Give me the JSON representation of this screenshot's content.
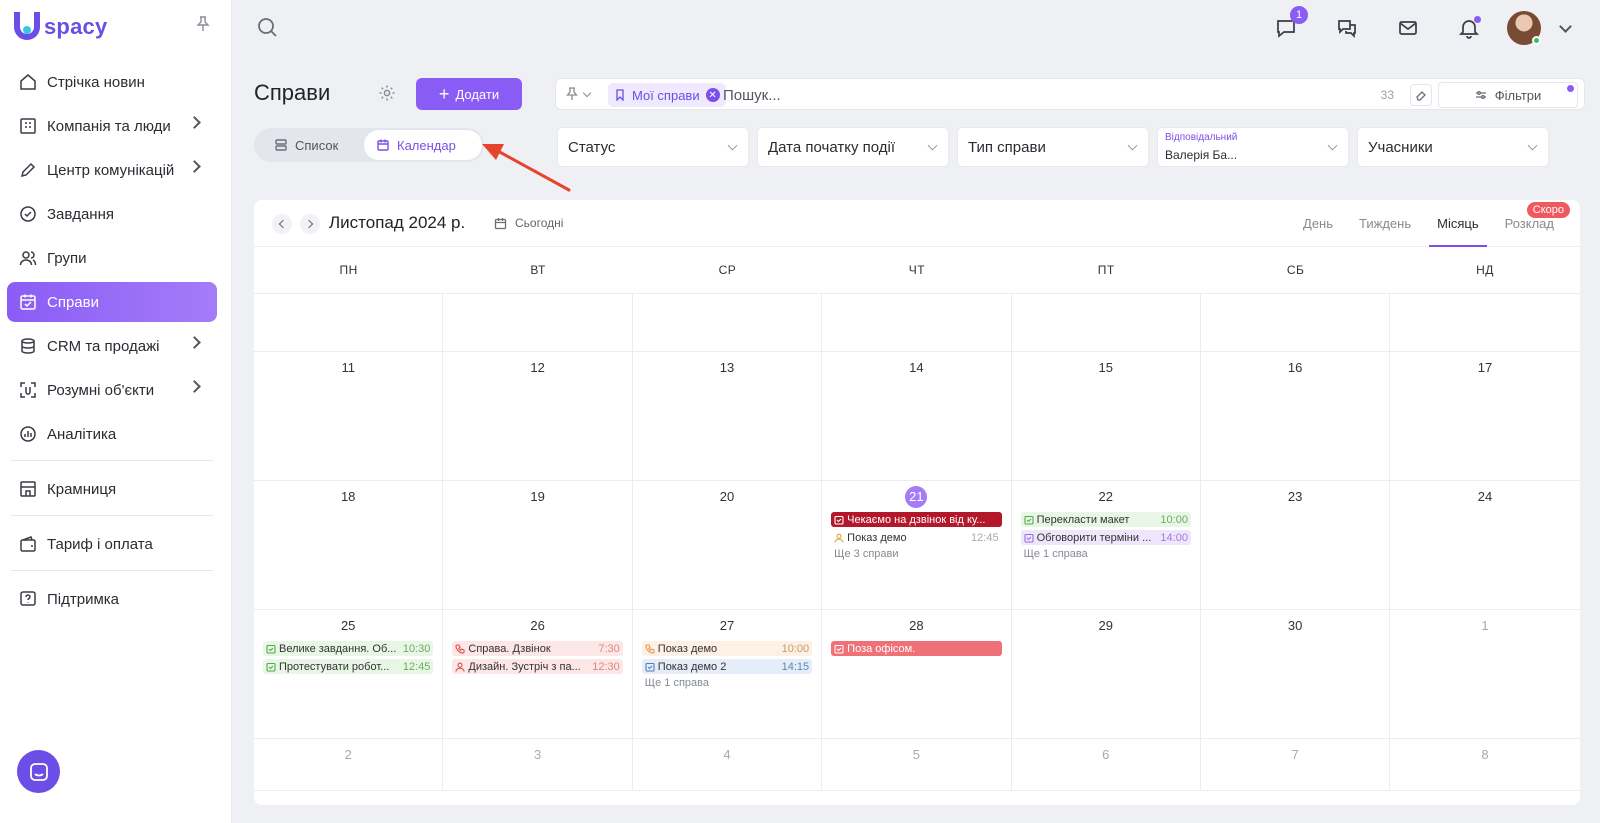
{
  "app": {
    "logo_text": "spacy"
  },
  "sidebar": {
    "items": [
      {
        "label": "Стрічка новин",
        "icon": "home-icon",
        "chevron": false,
        "active": false
      },
      {
        "label": "Компанія та люди",
        "icon": "building-icon",
        "chevron": true,
        "active": false
      },
      {
        "label": "Центр комунікацій",
        "icon": "edit-icon",
        "chevron": true,
        "active": false
      },
      {
        "label": "Завдання",
        "icon": "check-circle-icon",
        "chevron": false,
        "active": false
      },
      {
        "label": "Групи",
        "icon": "users-icon",
        "chevron": false,
        "active": false
      },
      {
        "label": "Справи",
        "icon": "calendar-check-icon",
        "chevron": false,
        "active": true
      },
      {
        "label": "CRM та продажі",
        "icon": "database-icon",
        "chevron": true,
        "active": false
      },
      {
        "label": "Розумні об'єкти",
        "icon": "scan-icon",
        "chevron": true,
        "active": false
      },
      {
        "label": "Аналітика",
        "icon": "chart-icon",
        "chevron": false,
        "active": false
      }
    ],
    "store": {
      "label": "Крамниця",
      "icon": "store-icon"
    },
    "billing": {
      "label": "Тариф і оплата",
      "icon": "wallet-icon"
    },
    "support": {
      "label": "Підтримка",
      "icon": "help-icon"
    }
  },
  "topbar": {
    "messages_badge": "1"
  },
  "header": {
    "title": "Справи",
    "add_label": "Додати",
    "view_list": "Список",
    "view_calendar": "Календар"
  },
  "search": {
    "chip": "Мої справи",
    "placeholder": "Пошук...",
    "count": "33",
    "filters_label": "Фільтри"
  },
  "filters": {
    "status": "Статус",
    "start_date": "Дата початку події",
    "type": "Тип справи",
    "responsible_label": "Відповідальний",
    "responsible_value": "Валерія Ба...",
    "participants": "Учасники"
  },
  "calendar": {
    "month_title": "Листопад 2024 р.",
    "today_label": "Сьогодні",
    "views": {
      "day": "День",
      "week": "Тиждень",
      "month": "Місяць",
      "schedule": "Розклад"
    },
    "soon_badge": "Скоро",
    "weekdays": [
      "ПН",
      "ВТ",
      "СР",
      "ЧТ",
      "ПТ",
      "СБ",
      "НД"
    ],
    "weeks": [
      {
        "days": [
          {
            "num": ""
          },
          {
            "num": ""
          },
          {
            "num": ""
          },
          {
            "num": ""
          },
          {
            "num": ""
          },
          {
            "num": ""
          },
          {
            "num": ""
          }
        ]
      },
      {
        "days": [
          {
            "num": "11"
          },
          {
            "num": "12"
          },
          {
            "num": "13"
          },
          {
            "num": "14"
          },
          {
            "num": "15"
          },
          {
            "num": "16"
          },
          {
            "num": "17"
          }
        ]
      },
      {
        "days": [
          {
            "num": "18"
          },
          {
            "num": "19"
          },
          {
            "num": "20"
          },
          {
            "num": "21",
            "today": true,
            "events": [
              {
                "title": "Чекаємо на дзвінок від ку...",
                "time": "",
                "color": "red",
                "icon": "task-icon"
              },
              {
                "title": "Показ демо",
                "time": "12:45",
                "color": "cream",
                "icon": "people-icon"
              }
            ],
            "more": "Ще 3 справи"
          },
          {
            "num": "22",
            "events": [
              {
                "title": "Перекласти макет",
                "time": "10:00",
                "color": "green",
                "icon": "task-icon"
              },
              {
                "title": "Обговорити терміни ...",
                "time": "14:00",
                "color": "purple",
                "icon": "task-icon"
              }
            ],
            "more": "Ще 1 справа"
          },
          {
            "num": "23"
          },
          {
            "num": "24"
          }
        ]
      },
      {
        "days": [
          {
            "num": "25",
            "events": [
              {
                "title": "Велике завдання. Об...",
                "time": "10:30",
                "color": "green",
                "icon": "task-icon"
              },
              {
                "title": "Протестувати робот...",
                "time": "12:45",
                "color": "green",
                "icon": "task-icon"
              }
            ]
          },
          {
            "num": "26",
            "events": [
              {
                "title": "Справа. Дзвінок",
                "time": "7:30",
                "color": "pink",
                "icon": "phone-icon"
              },
              {
                "title": "Дизайн. Зустріч з па...",
                "time": "12:30",
                "color": "pink",
                "icon": "people-icon"
              }
            ]
          },
          {
            "num": "27",
            "events": [
              {
                "title": "Показ демо",
                "time": "10:00",
                "color": "peach",
                "icon": "phone-icon"
              },
              {
                "title": "Показ демо 2",
                "time": "14:15",
                "color": "blue",
                "icon": "task-icon"
              }
            ],
            "more": "Ще 1 справа"
          },
          {
            "num": "28",
            "events": [
              {
                "title": "Поза офісом.",
                "time": "",
                "color": "salmon",
                "icon": "task-icon"
              }
            ]
          },
          {
            "num": "29"
          },
          {
            "num": "30"
          },
          {
            "num": "1",
            "other": true
          }
        ]
      },
      {
        "days": [
          {
            "num": "2",
            "other": true
          },
          {
            "num": "3",
            "other": true
          },
          {
            "num": "4",
            "other": true
          },
          {
            "num": "5",
            "other": true
          },
          {
            "num": "6",
            "other": true
          },
          {
            "num": "7",
            "other": true
          },
          {
            "num": "8",
            "other": true
          }
        ]
      }
    ]
  },
  "colors": {
    "accent": "#8a5cf6",
    "brand": "#6b4ee6",
    "danger": "#b3182a"
  }
}
